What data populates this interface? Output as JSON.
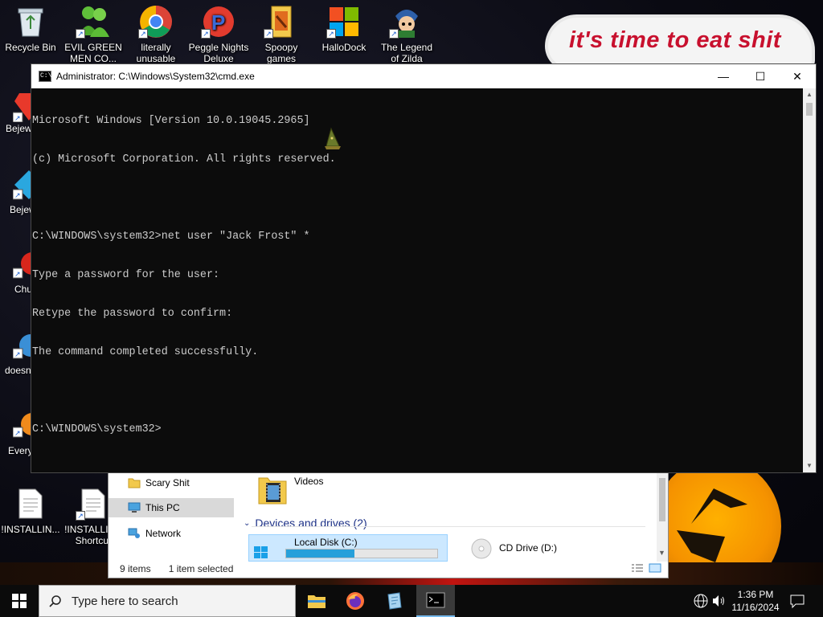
{
  "desktop": {
    "banner": "it's time to eat shit",
    "icons": [
      {
        "label": "Recycle Bin"
      },
      {
        "label": "EVIL GREEN MEN CO..."
      },
      {
        "label": "literally unusable"
      },
      {
        "label": "Peggle Nights Deluxe"
      },
      {
        "label": "Spoopy games"
      },
      {
        "label": "HalloDock"
      },
      {
        "label": "The Legend of Zilda"
      }
    ],
    "left_labels": [
      "Bejew Delu",
      "Bejew Delu",
      "Chu Delu",
      "doesn",
      "Every"
    ],
    "bottom_icons": [
      {
        "label": "!INSTALLIN..."
      },
      {
        "label": "!INSTALLI... - Shortcut"
      }
    ]
  },
  "cmd": {
    "title": "Administrator: C:\\Windows\\System32\\cmd.exe",
    "lines": [
      "Microsoft Windows [Version 10.0.19045.2965]",
      "(c) Microsoft Corporation. All rights reserved.",
      "",
      "C:\\WINDOWS\\system32>net user \"Jack Frost\" *",
      "Type a password for the user:",
      "Retype the password to confirm:",
      "The command completed successfully.",
      "",
      "C:\\WINDOWS\\system32>"
    ],
    "minimize": "—",
    "maximize": "☐",
    "close": "✕"
  },
  "explorer": {
    "nav": [
      {
        "label": "Scary Shit",
        "selected": false
      },
      {
        "label": "This PC",
        "selected": true
      },
      {
        "label": "Network",
        "selected": false
      }
    ],
    "folder": "Videos",
    "section": "Devices and drives (2)",
    "drives": [
      {
        "label": "Local Disk (C:)",
        "usage": 0.45
      },
      {
        "label": "CD Drive (D:)"
      }
    ],
    "status_items": "9 items",
    "status_selected": "1 item selected"
  },
  "taskbar": {
    "search_placeholder": "Type here to search",
    "time": "1:36 PM",
    "date": "11/16/2024"
  },
  "colors": {
    "cmd_bg": "#0c0c0c",
    "cmd_text": "#cccccc",
    "banner_red": "#c8102e",
    "taskbar_bg": "#0b0b0b",
    "drive_fill": "#26a0da"
  }
}
